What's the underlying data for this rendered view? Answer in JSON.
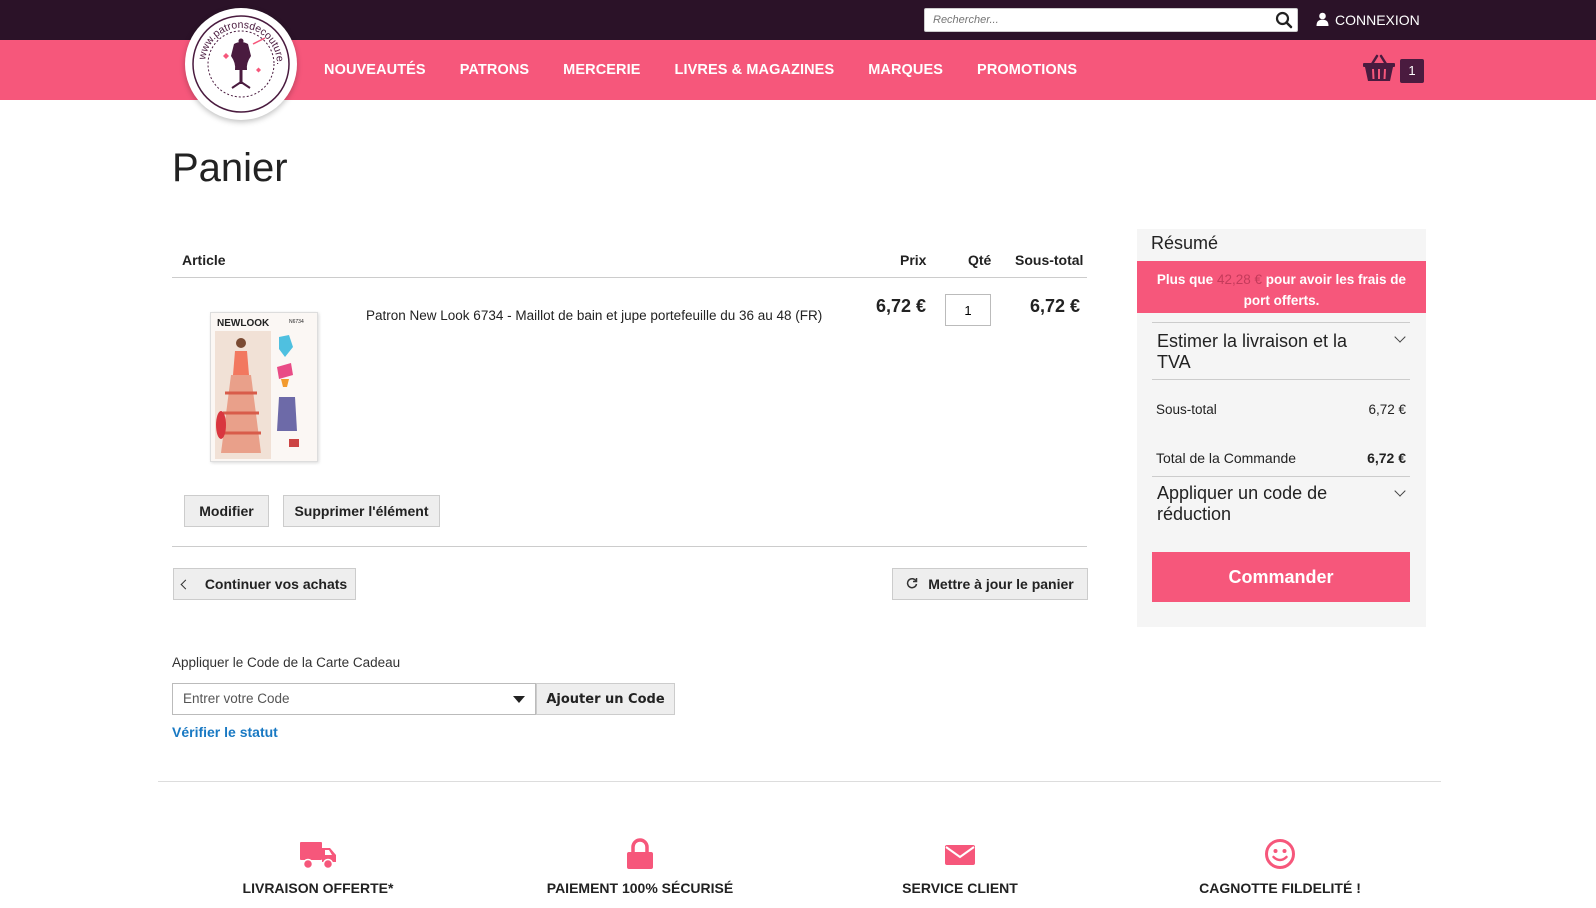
{
  "header": {
    "search_placeholder": "Rechercher...",
    "login_label": "CONNEXION",
    "cart_count": "1",
    "logo_text": "www.patronsdecouture.com"
  },
  "nav": {
    "items": [
      "NOUVEAUTÉS",
      "PATRONS",
      "MERCERIE",
      "LIVRES & MAGAZINES",
      "MARQUES",
      "PROMOTIONS"
    ]
  },
  "page": {
    "title": "Panier"
  },
  "cart_table": {
    "headers": {
      "article": "Article",
      "price": "Prix",
      "qty": "Qté",
      "subtotal": "Sous-total"
    },
    "item": {
      "name": "Patron New Look 6734 - Maillot de bain et jupe portefeuille du 36 au 48 (FR)",
      "price": "6,72 €",
      "qty": "1",
      "subtotal": "6,72 €",
      "image_brand": "NEWLOOK",
      "image_code": "N6734"
    },
    "edit_label": "Modifier",
    "remove_label": "Supprimer l'élément",
    "continue_label": "Continuer vos achats",
    "update_label": "Mettre à jour le panier"
  },
  "gift_card": {
    "label": "Appliquer le Code de la Carte Cadeau",
    "placeholder": "Entrer votre Code",
    "add_label": "Ajouter un Code",
    "verify_label": "Vérifier le statut"
  },
  "summary": {
    "title": "Résumé",
    "shipping_prefix": "Plus que",
    "shipping_amount": "42,28 €",
    "shipping_suffix": "pour avoir les frais de port offerts.",
    "estimate_label": "Estimer la livraison et la TVA",
    "subtotal_label": "Sous-total",
    "subtotal_value": "6,72 €",
    "total_label": "Total de la Commande",
    "total_value": "6,72 €",
    "discount_label": "Appliquer un code de réduction",
    "checkout_label": "Commander"
  },
  "features": [
    {
      "icon": "truck-icon",
      "label": "LIVRAISON OFFERTE*"
    },
    {
      "icon": "lock-icon",
      "label": "PAIEMENT 100% SÉCURISÉ"
    },
    {
      "icon": "envelope-icon",
      "label": "SERVICE CLIENT"
    },
    {
      "icon": "smiley-icon",
      "label": "CAGNOTTE FILDELITÉ !"
    }
  ],
  "colors": {
    "topbar": "#2b1228",
    "brand_pink": "#f6577b",
    "dark_purple": "#4a1b3f",
    "link_blue": "#1979c3"
  }
}
